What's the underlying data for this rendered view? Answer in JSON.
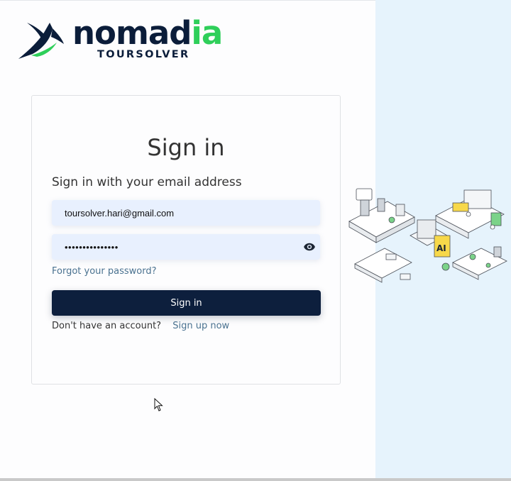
{
  "brand": {
    "name_main": "nomad",
    "name_accent": "ia",
    "subtitle": "TOURSOLVER",
    "colors": {
      "navy": "#0b1d3a",
      "green": "#2fcf5a"
    }
  },
  "signin": {
    "title": "Sign in",
    "subtitle": "Sign in with your email address",
    "email_value": "toursolver.hari@gmail.com",
    "password_value": "•••••••••••••••",
    "show_password_icon": "eye-icon",
    "forgot_label": "Forgot your password?",
    "submit_label": "Sign in",
    "no_account_text": "Don't have an account?",
    "signup_label": "Sign up now"
  },
  "colors": {
    "button": "#0d1f3d",
    "link": "#4a7290",
    "input_bg": "#e8f0fe",
    "side_panel": "#e6f3fc"
  },
  "illustration": "isometric-logistics-illustration",
  "pointer": "arrow-cursor"
}
